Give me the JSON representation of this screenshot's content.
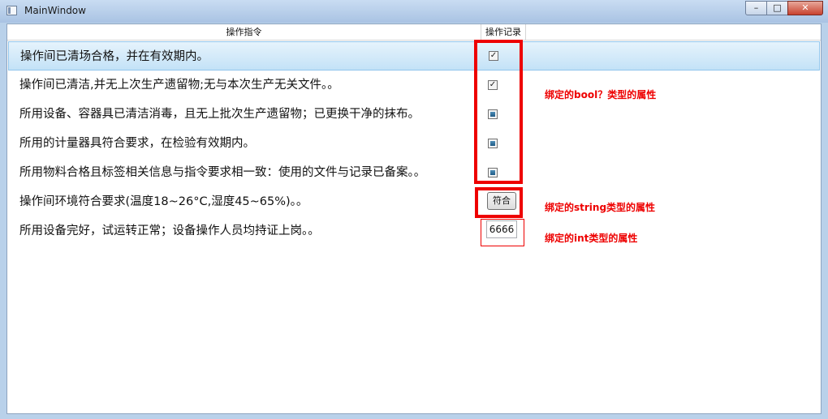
{
  "window": {
    "title": "MainWindow",
    "minimize": "–",
    "maximize": "□",
    "close": "✕"
  },
  "grid": {
    "headers": [
      "操作指令",
      "操作记录"
    ],
    "rows": [
      {
        "text": "操作间已清场合格，并在有效期内。",
        "control": "checkbox",
        "state": "checked"
      },
      {
        "text": "操作间已清洁,并无上次生产遗留物;无与本次生产无关文件。。",
        "control": "checkbox",
        "state": "checked"
      },
      {
        "text": "所用设备、容器具已清洁消毒，且无上批次生产遗留物；已更换干净的抹布。",
        "control": "checkbox",
        "state": "indeterminate"
      },
      {
        "text": "所用的计量器具符合要求，在检验有效期内。",
        "control": "checkbox",
        "state": "indeterminate"
      },
      {
        "text": "所用物料合格且标签相关信息与指令要求相一致：使用的文件与记录已备案。。",
        "control": "checkbox",
        "state": "indeterminate"
      },
      {
        "text": "操作间环境符合要求(温度18~26°C,湿度45~65%)。。",
        "control": "string",
        "value": "符合"
      },
      {
        "text": "所用设备完好，试运转正常；设备操作人员均持证上岗。。",
        "control": "int",
        "value": "6666"
      }
    ]
  },
  "annotations": {
    "bool_note": "绑定的bool？类型的属性",
    "string_note": "绑定的string类型的属性",
    "int_note": "绑定的int类型的属性"
  },
  "colors": {
    "highlight": "#ee0000",
    "selection": "#c3e2f7"
  }
}
